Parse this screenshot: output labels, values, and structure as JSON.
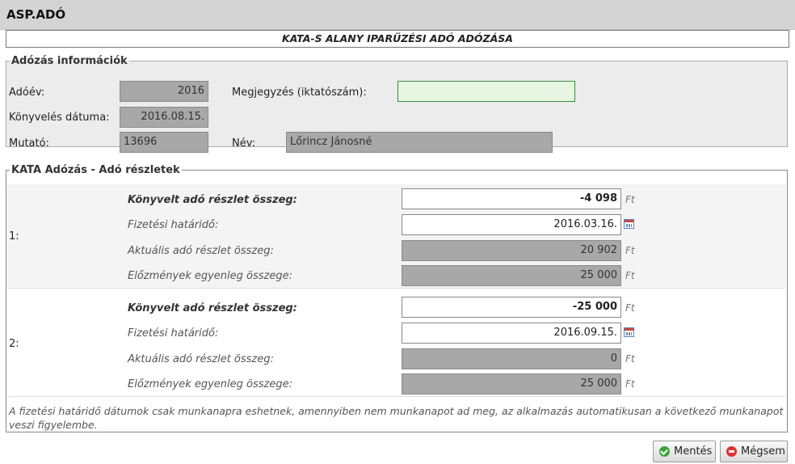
{
  "app": {
    "title": "ASP.ADÓ"
  },
  "form": {
    "title": "KATA-S ALANY IPARŰZÉSI ADÓ ADÓZÁSA"
  },
  "info": {
    "legend": "Adózás információk",
    "adoev": {
      "label": "Adóév:",
      "value": "2016"
    },
    "konyveles": {
      "label": "Könyvelés dátuma:",
      "value": "2016.08.15."
    },
    "mutato": {
      "label": "Mutató:",
      "value": "13696"
    },
    "megjegyzes": {
      "label": "Megjegyzés (iktatószám):",
      "value": ""
    },
    "nev": {
      "label": "Név:",
      "value": "Lőrincz Jánosné"
    }
  },
  "kata": {
    "legend": "KATA Adózás - Adó részletek",
    "field_labels": {
      "konyvelt": "Könyvelt adó részlet összeg:",
      "hatarido": "Fizetési határidő:",
      "aktualis": "Aktuális adó részlet összeg:",
      "elozmenyek": "Előzmények egyenleg összege:"
    },
    "unit": "Ft",
    "installments": [
      {
        "index": "1:",
        "konyvelt": "-4 098",
        "hatarido": "2016.03.16.",
        "aktualis": "20 902",
        "elozmenyek": "25 000"
      },
      {
        "index": "2:",
        "konyvelt": "-25 000",
        "hatarido": "2016.09.15.",
        "aktualis": "0",
        "elozmenyek": "25 000"
      }
    ],
    "footnote": "A fizetési határidő dátumok csak munkanapra eshetnek, amennyiben nem munkanapot ad meg, az alkalmazás automatikusan a következő munkanapot veszi figyelembe."
  },
  "buttons": {
    "save": "Mentés",
    "cancel": "Mégsem"
  },
  "icons": {
    "calendar": "calendar-icon",
    "save": "check-circle-icon",
    "cancel": "minus-circle-icon"
  }
}
